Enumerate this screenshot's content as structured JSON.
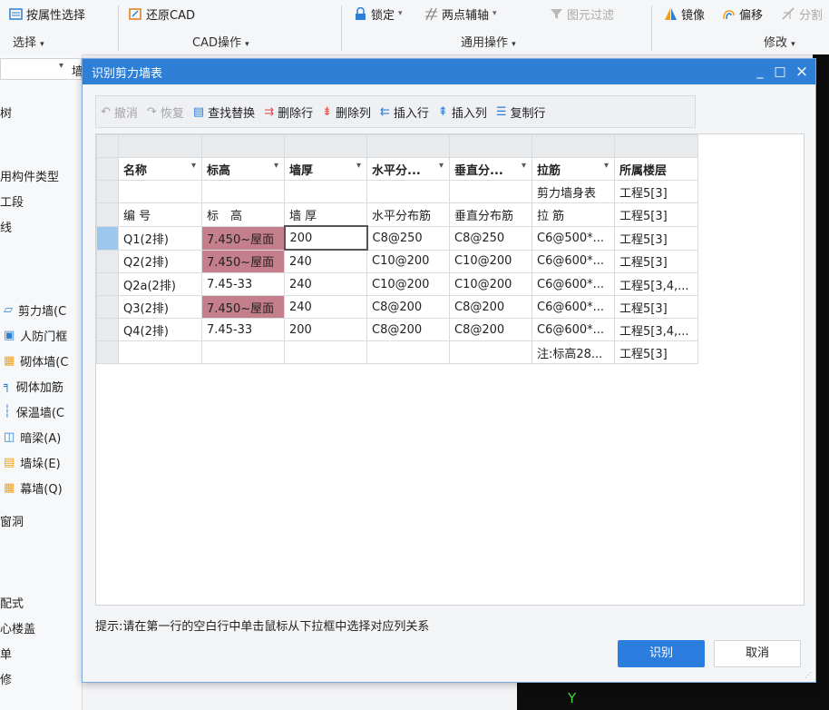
{
  "ribbon": {
    "select_by_attr": "按属性选择",
    "restore_cad": "还原CAD",
    "lock": "锁定",
    "two_point_axis": "两点辅轴",
    "element_filter": "图元过滤",
    "mirror": "镜像",
    "offset": "偏移",
    "split": "分割",
    "groups": [
      "选择",
      "CAD操作",
      "通用操作",
      "修改"
    ]
  },
  "leftpanel": {
    "dropdown_arrow": "▾",
    "dropdown_text": "墙",
    "items": [
      "树",
      "用构件类型",
      "工段",
      "线",
      "剪力墙(C",
      "人防门框",
      "砌体墙(C",
      "砌体加筋",
      "保温墙(C",
      "暗梁(A)",
      "墙垛(E)",
      "幕墙(Q)",
      "窗洞",
      "配式",
      "心楼盖",
      "单",
      "修"
    ]
  },
  "dialog": {
    "title": "识别剪力墙表",
    "minimize": "_",
    "maximize": "□",
    "close": "×",
    "toolbar": [
      "撤消",
      "恢复",
      "查找替换",
      "删除行",
      "删除列",
      "插入行",
      "插入列",
      "复制行"
    ],
    "columns": [
      "名称",
      "标高",
      "墙厚",
      "水平分...",
      "垂直分...",
      "拉筋",
      "所属楼层"
    ],
    "rows": [
      [
        "",
        "",
        "",
        "",
        "",
        "剪力墙身表",
        "工程5[3]"
      ],
      [
        "编 号",
        "标　高",
        "墙 厚",
        "水平分布筋",
        "垂直分布筋",
        "拉 筋",
        "工程5[3]"
      ],
      [
        "Q1(2排)",
        "7.450~屋面",
        "200",
        "C8@250",
        "C8@250",
        "C6@500*...",
        "工程5[3]"
      ],
      [
        "Q2(2排)",
        "7.450~屋面",
        "240",
        "C10@200",
        "C10@200",
        "C6@600*...",
        "工程5[3]"
      ],
      [
        "Q2a(2排)",
        "7.45-33",
        "240",
        "C10@200",
        "C10@200",
        "C6@600*...",
        "工程5[3,4,..."
      ],
      [
        "Q3(2排)",
        "7.450~屋面",
        "240",
        "C8@200",
        "C8@200",
        "C6@600*...",
        "工程5[3]"
      ],
      [
        "Q4(2排)",
        "7.45-33",
        "200",
        "C8@200",
        "C8@200",
        "C6@600*...",
        "工程5[3,4,..."
      ],
      [
        "",
        "",
        "",
        "",
        "",
        "注:标高28...",
        "工程5[3]"
      ]
    ],
    "hint": "提示:请在第一行的空白行中单击鼠标从下拉框中选择对应列关系",
    "ok": "识别",
    "cancel": "取消"
  },
  "cad": {
    "axis_label": "Y"
  },
  "colors": {
    "title_blue": "#2f7fd6",
    "ok_blue": "#2b7de0",
    "pink": "#c47e8c",
    "col_sel": "#8fbff0"
  }
}
